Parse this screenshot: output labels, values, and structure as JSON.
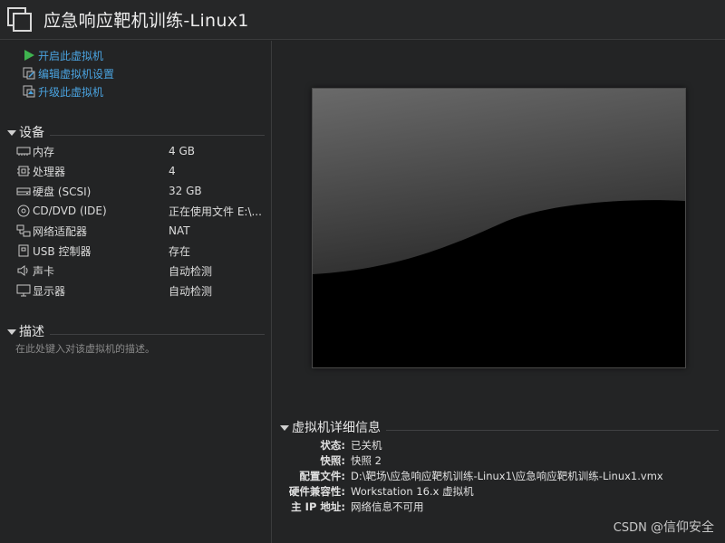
{
  "window": {
    "title": "应急响应靶机训练-Linux1"
  },
  "actions": [
    {
      "label": "开启此虚拟机",
      "icon": "power-on-icon"
    },
    {
      "label": "编辑虚拟机设置",
      "icon": "edit-settings-icon"
    },
    {
      "label": "升级此虚拟机",
      "icon": "upgrade-icon"
    }
  ],
  "devices": {
    "header": "设备",
    "items": [
      {
        "name": "内存",
        "value": "4 GB",
        "icon": "memory-icon"
      },
      {
        "name": "处理器",
        "value": "4",
        "icon": "cpu-icon"
      },
      {
        "name": "硬盘 (SCSI)",
        "value": "32 GB",
        "icon": "disk-icon"
      },
      {
        "name": "CD/DVD (IDE)",
        "value": "正在使用文件 E:\\...",
        "icon": "cd-icon"
      },
      {
        "name": "网络适配器",
        "value": "NAT",
        "icon": "network-icon"
      },
      {
        "name": "USB 控制器",
        "value": "存在",
        "icon": "usb-icon"
      },
      {
        "name": "声卡",
        "value": "自动检测",
        "icon": "speaker-icon"
      },
      {
        "name": "显示器",
        "value": "自动检测",
        "icon": "monitor-icon"
      }
    ]
  },
  "description": {
    "header": "描述",
    "placeholder": "在此处键入对该虚拟机的描述。"
  },
  "details": {
    "header": "虚拟机详细信息",
    "rows": [
      {
        "key": "状态:",
        "value": "已关机"
      },
      {
        "key": "快照:",
        "value": "快照 2"
      },
      {
        "key": "配置文件:",
        "value": "D:\\靶场\\应急响应靶机训练-Linux1\\应急响应靶机训练-Linux1.vmx"
      },
      {
        "key": "硬件兼容性:",
        "value": "Workstation 16.x 虚拟机"
      },
      {
        "key": "主 IP 地址:",
        "value": "网络信息不可用"
      }
    ]
  },
  "watermark": {
    "text": "CSDN",
    "sub": "@信仰安全"
  },
  "colors": {
    "link": "#4aa3e0",
    "power_green": "#3fb34f",
    "background": "#232425"
  }
}
